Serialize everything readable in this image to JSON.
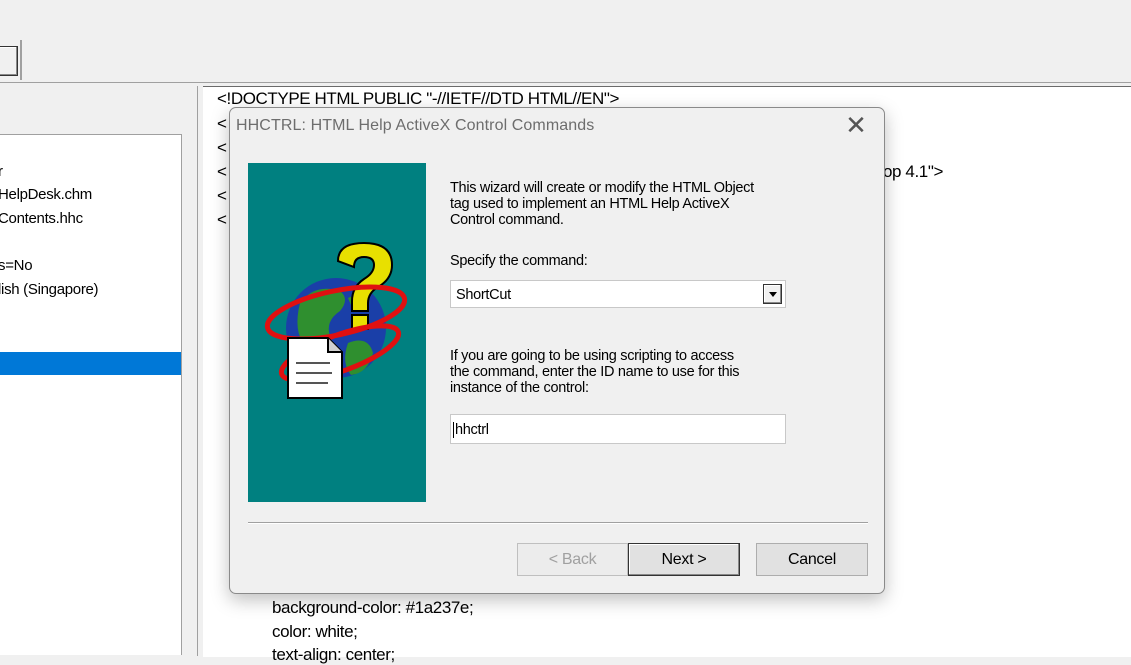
{
  "left_pane": {
    "items": [
      "r",
      "HelpDesk.chm",
      "Contents.hhc",
      "s=No",
      "lish (Singapore)"
    ]
  },
  "editor": {
    "lines": [
      "<!DOCTYPE HTML PUBLIC \"-//IETF//DTD HTML//EN\">",
      "<",
      "<",
      "<",
      "<",
      "<",
      "op 4.1\">",
      "background-color: #1a237e;",
      "color: white;",
      "text-align: center;"
    ]
  },
  "dialog": {
    "title": "HHCTRL:  HTML Help ActiveX Control Commands",
    "close_glyph": "✕",
    "intro_line1": "This wizard will create or modify the HTML Object",
    "intro_line2": "tag used to implement an HTML Help ActiveX",
    "intro_line3": "Control command.",
    "command_label": "Specify the command:",
    "command_value": "ShortCut",
    "id_label_line1": "If you are going to be using scripting to access",
    "id_label_line2": "the command, enter the ID name to use for this",
    "id_label_line3": "instance of the control:",
    "id_value": "hhctrl",
    "back_label": "< Back",
    "next_label": "Next >",
    "cancel_label": "Cancel"
  },
  "icons": {
    "wizard_image": "help-globe-document-icon",
    "dropdown": "chevron-down-icon",
    "close": "close-icon"
  },
  "colors": {
    "wizard_panel": "#008080",
    "selection": "#0078d7"
  }
}
